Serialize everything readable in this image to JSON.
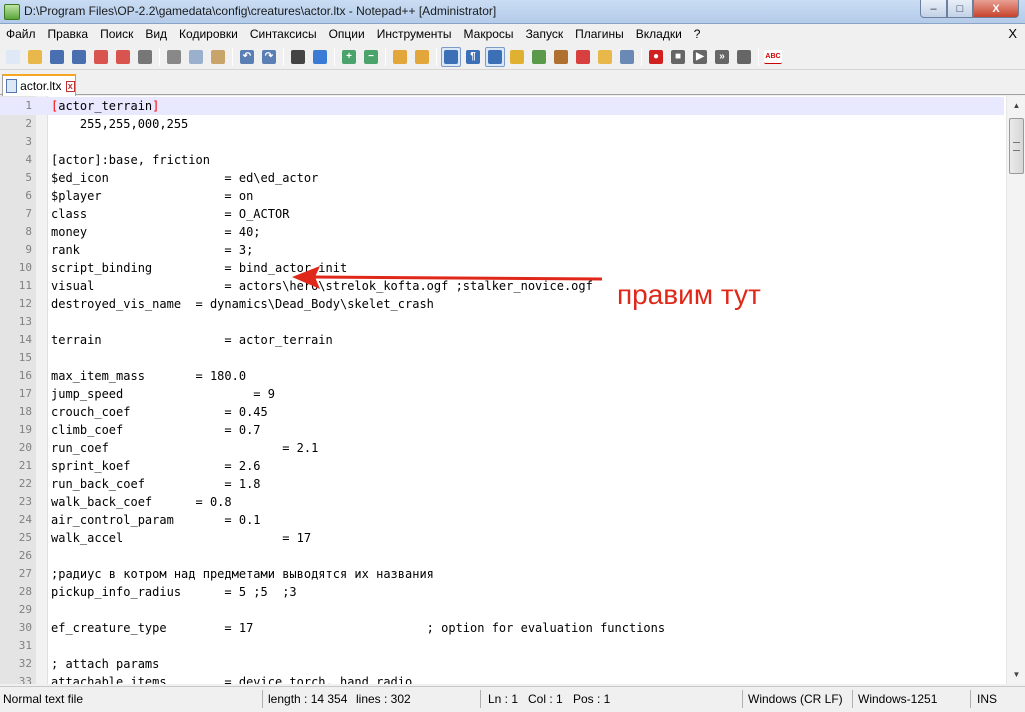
{
  "window": {
    "title": "D:\\Program Files\\OP-2.2\\gamedata\\config\\creatures\\actor.ltx - Notepad++ [Administrator]",
    "min_label": "–",
    "max_label": "□",
    "close_label": "X"
  },
  "menu": {
    "items": [
      "Файл",
      "Правка",
      "Поиск",
      "Вид",
      "Кодировки",
      "Синтаксисы",
      "Опции",
      "Инструменты",
      "Макросы",
      "Запуск",
      "Плагины",
      "Вкладки",
      "?"
    ],
    "close_label": "X"
  },
  "toolbar": {
    "groups": [
      [
        {
          "icon": "new-file-icon",
          "color": "#dfe8f5",
          "glyph": ""
        },
        {
          "icon": "open-file-icon",
          "color": "#e8b84a",
          "glyph": ""
        },
        {
          "icon": "save-icon",
          "color": "#4a6fb0",
          "glyph": ""
        },
        {
          "icon": "save-all-icon",
          "color": "#4a6fb0",
          "glyph": ""
        },
        {
          "icon": "close-file-icon",
          "color": "#d9534f",
          "glyph": ""
        },
        {
          "icon": "close-all-icon",
          "color": "#d9534f",
          "glyph": ""
        },
        {
          "icon": "print-icon",
          "color": "#777777",
          "glyph": ""
        }
      ],
      [
        {
          "icon": "cut-icon",
          "color": "#888888",
          "glyph": ""
        },
        {
          "icon": "copy-icon",
          "color": "#9ab0cc",
          "glyph": ""
        },
        {
          "icon": "paste-icon",
          "color": "#c9a46a",
          "glyph": ""
        }
      ],
      [
        {
          "icon": "undo-icon",
          "color": "#5a7fb5",
          "glyph": "↶"
        },
        {
          "icon": "redo-icon",
          "color": "#5a7fb5",
          "glyph": "↷"
        }
      ],
      [
        {
          "icon": "find-icon",
          "color": "#444444",
          "glyph": ""
        },
        {
          "icon": "replace-icon",
          "color": "#3a7bd5",
          "glyph": ""
        }
      ],
      [
        {
          "icon": "zoom-in-icon",
          "color": "#4aa36a",
          "glyph": "+"
        },
        {
          "icon": "zoom-out-icon",
          "color": "#4aa36a",
          "glyph": "−"
        }
      ],
      [
        {
          "icon": "sync-vertical-icon",
          "color": "#e3a63a",
          "glyph": ""
        },
        {
          "icon": "sync-horizontal-icon",
          "color": "#e3a63a",
          "glyph": ""
        }
      ],
      [
        {
          "icon": "word-wrap-icon",
          "color": "#3b6fb6",
          "glyph": "",
          "active": true
        },
        {
          "icon": "show-all-chars-icon",
          "color": "#3b6fb6",
          "glyph": "¶"
        },
        {
          "icon": "indent-guide-icon",
          "color": "#3b6fb6",
          "glyph": "",
          "active": true
        },
        {
          "icon": "language-udl-icon",
          "color": "#e0b030",
          "glyph": ""
        },
        {
          "icon": "document-map-icon",
          "color": "#5a9a4a",
          "glyph": ""
        },
        {
          "icon": "function-list-icon",
          "color": "#b07030",
          "glyph": ""
        },
        {
          "icon": "folder-workspace-icon",
          "color": "#d84040",
          "glyph": ""
        },
        {
          "icon": "folder-icon",
          "color": "#e8b84a",
          "glyph": ""
        },
        {
          "icon": "monitoring-icon",
          "color": "#6a8ab5",
          "glyph": ""
        }
      ],
      [
        {
          "icon": "record-macro-icon",
          "color": "#d02020",
          "glyph": "●"
        },
        {
          "icon": "stop-macro-icon",
          "color": "#666666",
          "glyph": "■"
        },
        {
          "icon": "play-macro-icon",
          "color": "#666666",
          "glyph": "▶"
        },
        {
          "icon": "play-multiple-icon",
          "color": "#666666",
          "glyph": "»"
        },
        {
          "icon": "save-macro-icon",
          "color": "#666666",
          "glyph": ""
        }
      ],
      [
        {
          "icon": "spellcheck-icon",
          "color": "#ffffff",
          "glyph": "ABC"
        }
      ]
    ]
  },
  "tab": {
    "label": "actor.ltx",
    "close_label": "x"
  },
  "editor": {
    "lines": [
      {
        "n": "1",
        "text": "[actor_terrain]",
        "current": true
      },
      {
        "n": "2",
        "text": "    255,255,000,255"
      },
      {
        "n": "3",
        "text": ""
      },
      {
        "n": "4",
        "text": "[actor]:base, friction"
      },
      {
        "n": "5",
        "text": "$ed_icon                = ed\\ed_actor"
      },
      {
        "n": "6",
        "text": "$player                 = on"
      },
      {
        "n": "7",
        "text": "class                   = O_ACTOR"
      },
      {
        "n": "8",
        "text": "money                   = 40;"
      },
      {
        "n": "9",
        "text": "rank                    = 3;"
      },
      {
        "n": "10",
        "text": "script_binding          = bind_actor.init"
      },
      {
        "n": "11",
        "text": "visual                  = actors\\hero\\strelok_kofta.ogf ;stalker_novice.ogf"
      },
      {
        "n": "12",
        "text": "destroyed_vis_name  = dynamics\\Dead_Body\\skelet_crash"
      },
      {
        "n": "13",
        "text": ""
      },
      {
        "n": "14",
        "text": "terrain                 = actor_terrain"
      },
      {
        "n": "15",
        "text": ""
      },
      {
        "n": "16",
        "text": "max_item_mass       = 180.0"
      },
      {
        "n": "17",
        "text": "jump_speed                  = 9"
      },
      {
        "n": "18",
        "text": "crouch_coef             = 0.45"
      },
      {
        "n": "19",
        "text": "climb_coef              = 0.7"
      },
      {
        "n": "20",
        "text": "run_coef                        = 2.1"
      },
      {
        "n": "21",
        "text": "sprint_koef             = 2.6"
      },
      {
        "n": "22",
        "text": "run_back_coef           = 1.8"
      },
      {
        "n": "23",
        "text": "walk_back_coef      = 0.8"
      },
      {
        "n": "24",
        "text": "air_control_param       = 0.1"
      },
      {
        "n": "25",
        "text": "walk_accel                      = 17"
      },
      {
        "n": "26",
        "text": ""
      },
      {
        "n": "27",
        "text": ";радиус в котром над предметами выводятся их названия"
      },
      {
        "n": "28",
        "text": "pickup_info_radius      = 5 ;5  ;3"
      },
      {
        "n": "29",
        "text": ""
      },
      {
        "n": "30",
        "text": "ef_creature_type        = 17                        ; option for evaluation functions"
      },
      {
        "n": "31",
        "text": ""
      },
      {
        "n": "32",
        "text": "; attach params"
      },
      {
        "n": "33",
        "text": "attachable_items        = device_torch, hand_radio"
      }
    ]
  },
  "annotation": {
    "text": "правим тут",
    "color": "#e0281a"
  },
  "status": {
    "file_type": "Normal text file",
    "length": "length : 14 354",
    "lines": "lines : 302",
    "ln": "Ln : 1",
    "col": "Col : 1",
    "pos": "Pos : 1",
    "eol": "Windows (CR LF)",
    "encoding": "Windows-1251",
    "mode": "INS"
  }
}
